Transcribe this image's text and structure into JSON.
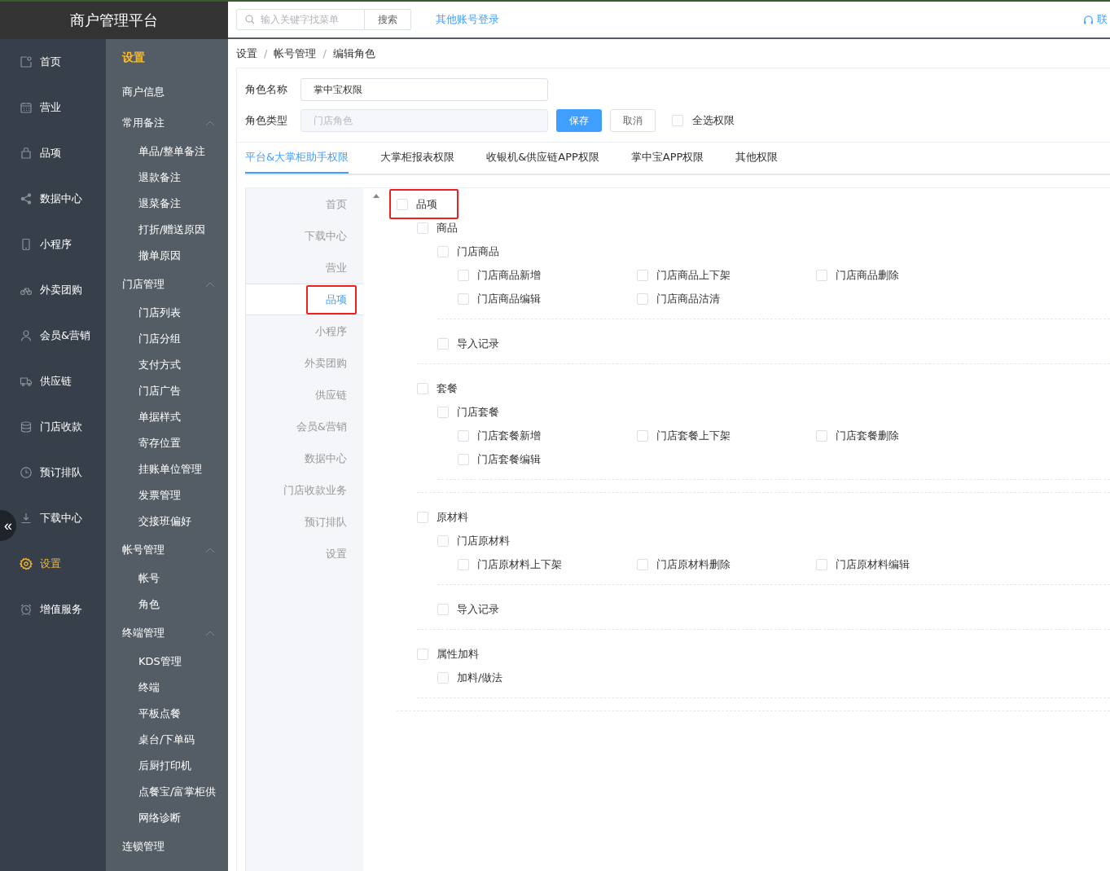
{
  "app_title": "商户管理平台",
  "collapse_button": "«",
  "rail": [
    {
      "label": "首页",
      "selected": false
    },
    {
      "label": "营业",
      "selected": false
    },
    {
      "label": "品项",
      "selected": false
    },
    {
      "label": "数据中心",
      "selected": false
    },
    {
      "label": "小程序",
      "selected": false
    },
    {
      "label": "外卖团购",
      "selected": false
    },
    {
      "label": "会员&营销",
      "selected": false
    },
    {
      "label": "供应链",
      "selected": false
    },
    {
      "label": "门店收款",
      "selected": false
    },
    {
      "label": "预订排队",
      "selected": false
    },
    {
      "label": "下载中心",
      "selected": false
    },
    {
      "label": "设置",
      "selected": true
    },
    {
      "label": "增值服务",
      "selected": false
    }
  ],
  "submenu": {
    "title": "设置",
    "groups": [
      {
        "kind": "link",
        "label": "商户信息"
      },
      {
        "kind": "group",
        "label": "常用备注",
        "expanded": true,
        "children": [
          "单品/整单备注",
          "退款备注",
          "退菜备注",
          "打折/赠送原因",
          "撤单原因"
        ]
      },
      {
        "kind": "group",
        "label": "门店管理",
        "expanded": true,
        "children": [
          "门店列表",
          "门店分组",
          "支付方式",
          "门店广告",
          "单据样式",
          "寄存位置",
          "挂账单位管理",
          "发票管理",
          "交接班偏好"
        ]
      },
      {
        "kind": "group",
        "label": "帐号管理",
        "expanded": true,
        "children": [
          "帐号",
          "角色"
        ]
      },
      {
        "kind": "group",
        "label": "终端管理",
        "expanded": true,
        "children": [
          "KDS管理",
          "终端",
          "平板点餐",
          "桌台/下单码",
          "后厨打印机",
          "点餐宝/富掌柜供",
          "网络诊断"
        ]
      },
      {
        "kind": "link",
        "label": "连锁管理"
      }
    ]
  },
  "topbar": {
    "search": {
      "placeholder": "输入关键字找菜单"
    },
    "search_button": "搜索",
    "other_login": "其他账号登录",
    "contact": "联"
  },
  "breadcrumb": {
    "separator": "/",
    "items": [
      "设置",
      "帐号管理",
      "编辑角色"
    ]
  },
  "form": {
    "role_name": {
      "label": "角色名称",
      "value": "掌中宝权限"
    },
    "role_type": {
      "label": "角色类型",
      "value": "门店角色",
      "disabled": true
    },
    "save": "保存",
    "cancel": "取消",
    "select_all": {
      "label": "全选权限",
      "checked": false
    }
  },
  "tabs": [
    {
      "label": "平台&大掌柜助手权限",
      "selected": true
    },
    {
      "label": "大掌柜报表权限",
      "selected": false
    },
    {
      "label": "收银机&供应链APP权限",
      "selected": false
    },
    {
      "label": "掌中宝APP权限",
      "selected": false
    },
    {
      "label": "其他权限",
      "selected": false
    }
  ],
  "perm_nav": [
    {
      "label": "首页",
      "selected": false,
      "highlighted": false
    },
    {
      "label": "下载中心",
      "selected": false,
      "highlighted": false
    },
    {
      "label": "营业",
      "selected": false,
      "highlighted": false
    },
    {
      "label": "品项",
      "selected": true,
      "highlighted": true
    },
    {
      "label": "小程序",
      "selected": false,
      "highlighted": false
    },
    {
      "label": "外卖团购",
      "selected": false,
      "highlighted": false
    },
    {
      "label": "供应链",
      "selected": false,
      "highlighted": false
    },
    {
      "label": "会员&营销",
      "selected": false,
      "highlighted": false
    },
    {
      "label": "数据中心",
      "selected": false,
      "highlighted": false
    },
    {
      "label": "门店收款业务",
      "selected": false,
      "highlighted": false
    },
    {
      "label": "预订排队",
      "selected": false,
      "highlighted": false
    },
    {
      "label": "设置",
      "selected": false,
      "highlighted": false
    }
  ],
  "tree": [
    {
      "label": "品项",
      "checked": false,
      "highlighted": true,
      "children": [
        {
          "label": "商品",
          "checked": false,
          "children": [
            {
              "label": "门店商品",
              "checked": false,
              "children": [
                {
                  "label": "门店商品新增",
                  "checked": false
                },
                {
                  "label": "门店商品上下架",
                  "checked": false
                },
                {
                  "label": "门店商品删除",
                  "checked": false
                },
                {
                  "label": "门店商品编辑",
                  "checked": false
                },
                {
                  "label": "门店商品沽清",
                  "checked": false
                }
              ]
            },
            {
              "label": "导入记录",
              "checked": false
            }
          ]
        },
        {
          "label": "套餐",
          "checked": false,
          "children": [
            {
              "label": "门店套餐",
              "checked": false,
              "children": [
                {
                  "label": "门店套餐新增",
                  "checked": false
                },
                {
                  "label": "门店套餐上下架",
                  "checked": false
                },
                {
                  "label": "门店套餐删除",
                  "checked": false
                },
                {
                  "label": "门店套餐编辑",
                  "checked": false
                }
              ]
            }
          ]
        },
        {
          "label": "原材料",
          "checked": false,
          "children": [
            {
              "label": "门店原材料",
              "checked": false,
              "children": [
                {
                  "label": "门店原材料上下架",
                  "checked": false
                },
                {
                  "label": "门店原材料删除",
                  "checked": false
                },
                {
                  "label": "门店原材料编辑",
                  "checked": false
                }
              ]
            },
            {
              "label": "导入记录",
              "checked": false
            }
          ]
        },
        {
          "label": "属性加料",
          "checked": false,
          "children": [
            {
              "label": "加料/做法",
              "checked": false
            }
          ]
        }
      ]
    }
  ]
}
